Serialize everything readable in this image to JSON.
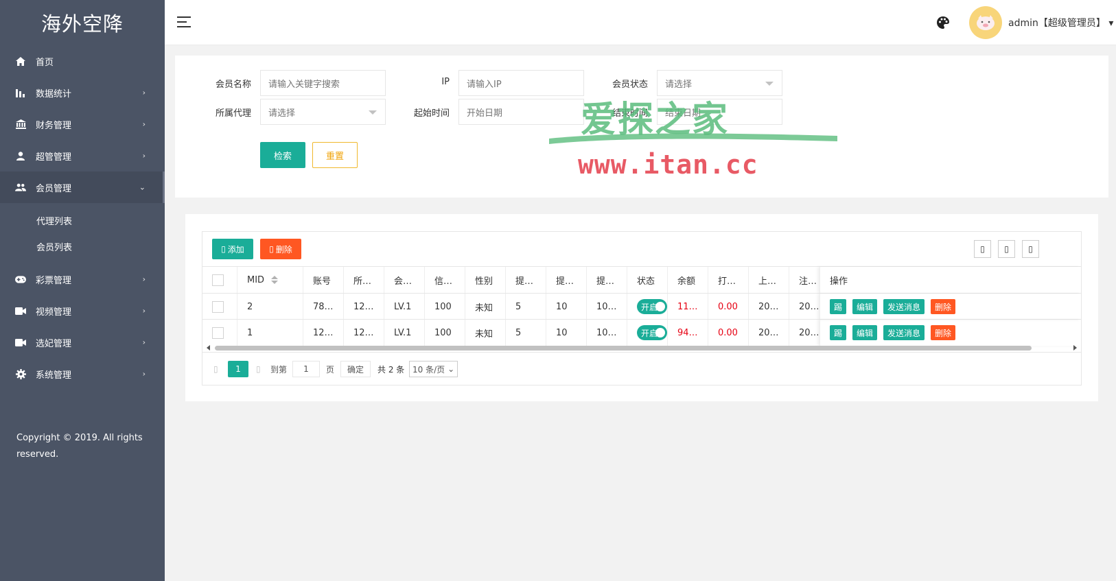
{
  "sidebar": {
    "logo": "海外空降",
    "items": [
      {
        "label": "首页",
        "icon": "home-icon",
        "chevron": ""
      },
      {
        "label": "数据统计",
        "icon": "chart-bars-icon",
        "chevron": "›"
      },
      {
        "label": "财务管理",
        "icon": "bank-icon",
        "chevron": "›"
      },
      {
        "label": "超管管理",
        "icon": "user-icon",
        "chevron": "›"
      },
      {
        "label": "会员管理",
        "icon": "users-icon",
        "chevron": "›"
      }
    ],
    "subitems": [
      "代理列表",
      "会员列表"
    ],
    "items2": [
      {
        "label": "彩票管理",
        "icon": "gamepad-icon",
        "chevron": "›"
      },
      {
        "label": "视频管理",
        "icon": "video-camera-icon",
        "chevron": "›"
      },
      {
        "label": "选妃管理",
        "icon": "video-camera-icon",
        "chevron": "›"
      },
      {
        "label": "系统管理",
        "icon": "gear-icon",
        "chevron": "›"
      }
    ],
    "copyright": "Copyright © 2019. All rights reserved."
  },
  "header": {
    "user": "admin【超级管理员】",
    "caret": "▾"
  },
  "search": {
    "member_name_label": "会员名称",
    "member_name_placeholder": "请输入关键字搜索",
    "ip_label": "IP",
    "ip_placeholder": "请输入IP",
    "status_label": "会员状态",
    "status_placeholder": "请选择",
    "agent_label": "所属代理",
    "agent_placeholder": "请选择",
    "start_label": "起始时间",
    "start_placeholder": "开始日期",
    "end_label": "结束时间",
    "end_placeholder": "结束日期",
    "search_btn": "检索",
    "reset_btn": "重置"
  },
  "watermark": {
    "text": "爱探之家",
    "url": "www.itan.cc"
  },
  "table": {
    "add_btn": "添加",
    "delete_btn": "删除",
    "columns": [
      "MID",
      "账号",
      "所…",
      "会…",
      "信…",
      "性别",
      "提…",
      "提…",
      "提…",
      "状态",
      "余额",
      "打…",
      "上…",
      "注…",
      "操作"
    ],
    "rows": [
      {
        "mid": "2",
        "account": "78…",
        "c3": "12…",
        "level": "LV.1",
        "credit": "100",
        "gender": "未知",
        "t1": "5",
        "t2": "10",
        "t3": "10…",
        "status": "开启",
        "balance": "11…",
        "bet": "0.00",
        "up": "20…",
        "reg": "20…"
      },
      {
        "mid": "1",
        "account": "12…",
        "c3": "12…",
        "level": "LV.1",
        "credit": "100",
        "gender": "未知",
        "t1": "5",
        "t2": "10",
        "t3": "10…",
        "status": "开启",
        "balance": "94…",
        "bet": "0.00",
        "up": "20…",
        "reg": "20…"
      }
    ],
    "ops": [
      "踢",
      "编辑",
      "发送消息",
      "删除"
    ],
    "pager": {
      "current": "1",
      "goto_label": "到第",
      "goto_value": "1",
      "page_unit": "页",
      "confirm": "确定",
      "total": "共 2 条",
      "per_page": "10 条/页"
    }
  },
  "colors": {
    "sidebar": "#4b5465",
    "accent": "#1aad98",
    "danger": "#ff5722",
    "warning": "#f0a40b",
    "red_text": "#e60012"
  }
}
